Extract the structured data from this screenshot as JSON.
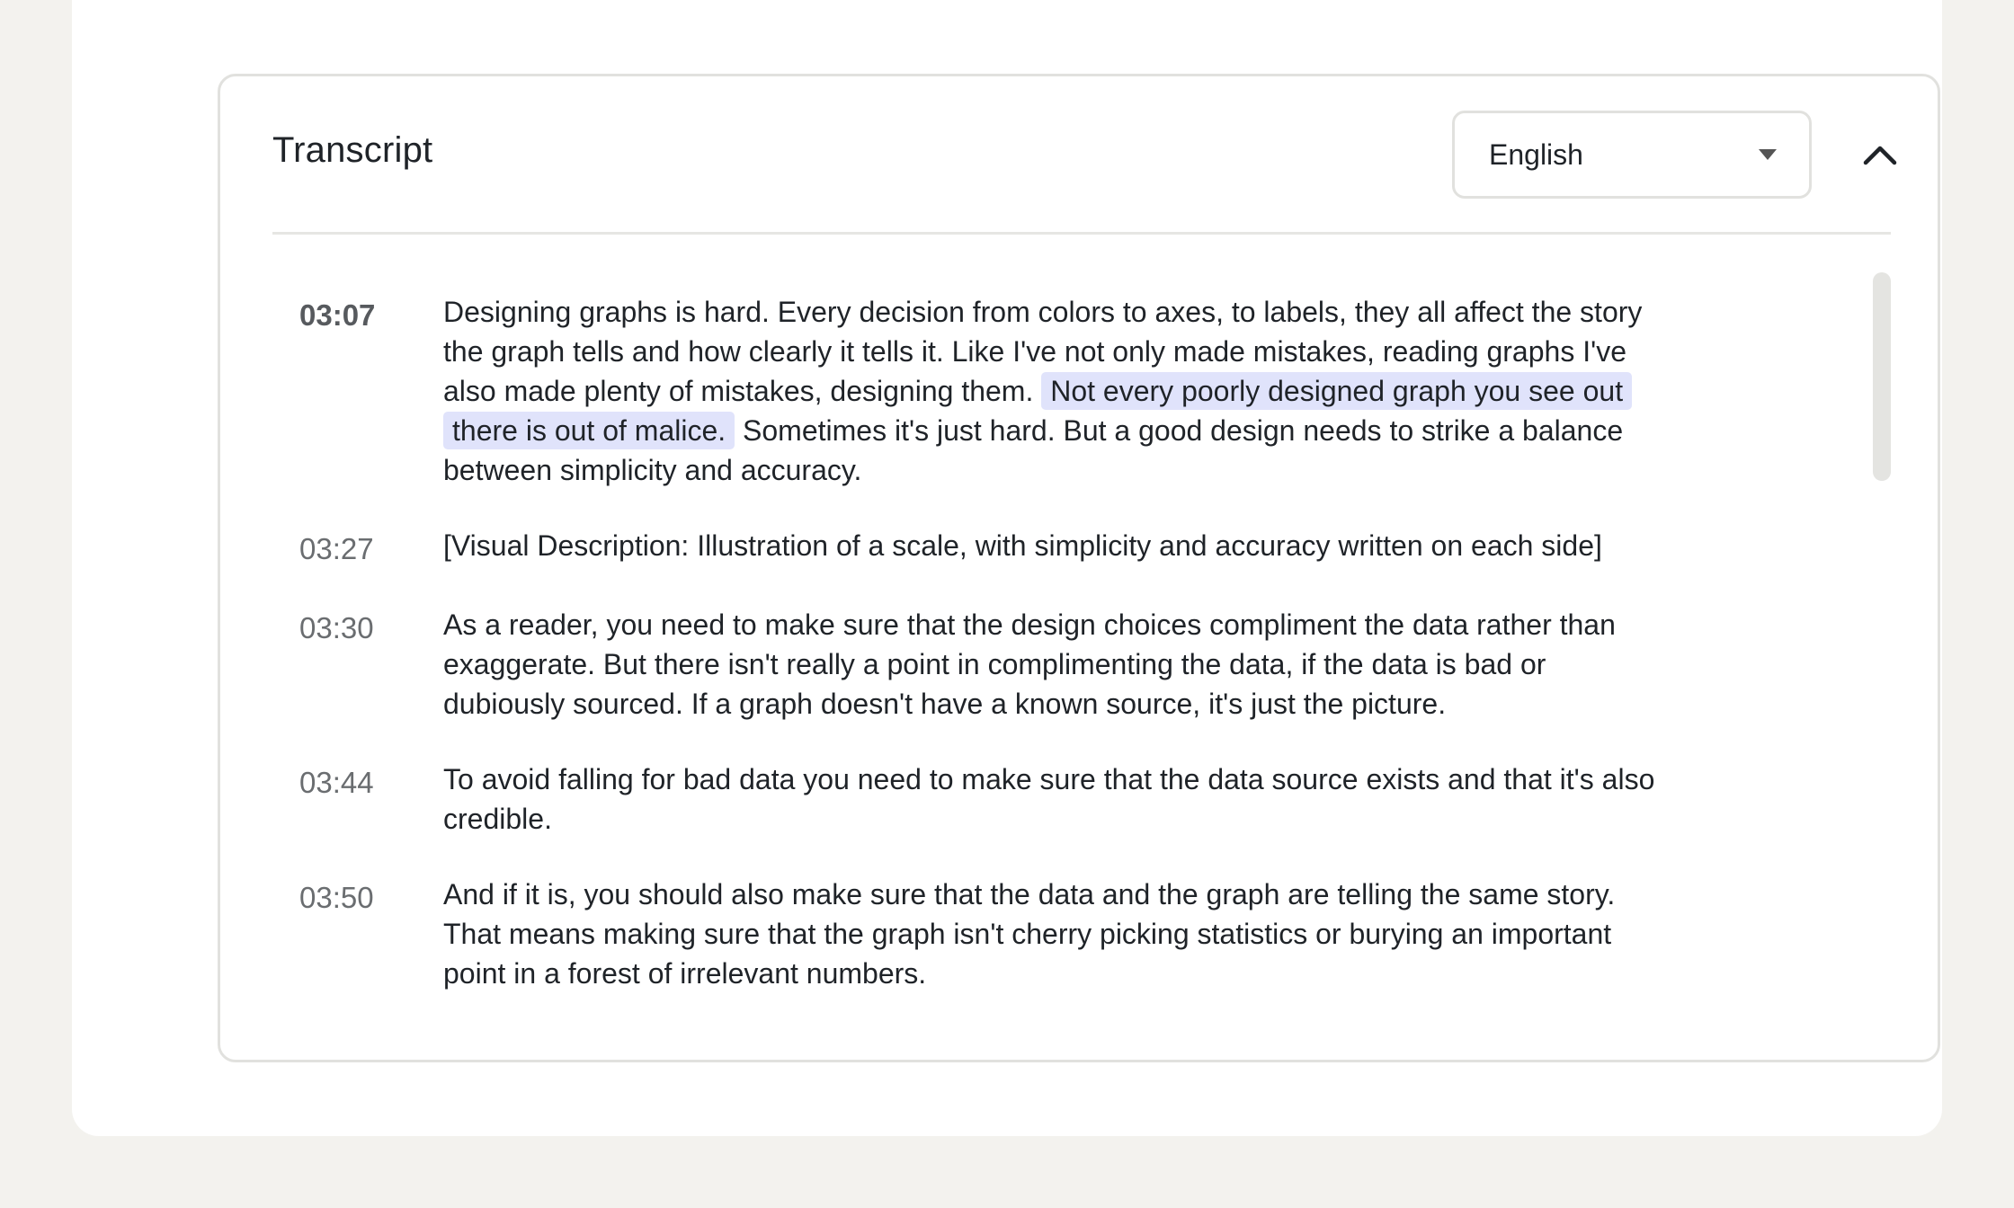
{
  "transcript": {
    "title": "Transcript",
    "language": {
      "selected": "English"
    },
    "icons": {
      "language_caret": "caret-down-icon",
      "collapse": "chevron-up-icon"
    },
    "highlight_color": "#e0e3fb",
    "entries": [
      {
        "time": "03:07",
        "active": true,
        "text_before": "Designing graphs is hard. Every decision from colors to axes, to labels, they all affect the story the graph tells and how clearly it tells it. Like I've not only made mistakes, reading graphs I've also made plenty of mistakes, designing them. ",
        "text_highlight": "Not every poorly designed graph you see out there is out of malice.",
        "text_after": " Sometimes it's just hard. But a good design needs to strike a balance between simplicity and accuracy."
      },
      {
        "time": "03:27",
        "text": "[Visual Description: Illustration of a scale, with simplicity and accuracy written on each side]"
      },
      {
        "time": "03:30",
        "text": "As a reader, you need to make sure that the design choices compliment the data rather than exaggerate. But there isn't really a point in complimenting the data, if the data is bad or dubiously sourced. If a graph doesn't have a known source, it's just the picture."
      },
      {
        "time": "03:44",
        "text": "To avoid falling for bad data you need to make sure that the data source exists and that it's also credible."
      },
      {
        "time": "03:50",
        "text": "And if it is, you should also make sure that the data and the graph are telling the same story. That means making sure that the graph isn't cherry picking statistics or burying an important point in a forest of irrelevant numbers."
      }
    ]
  }
}
